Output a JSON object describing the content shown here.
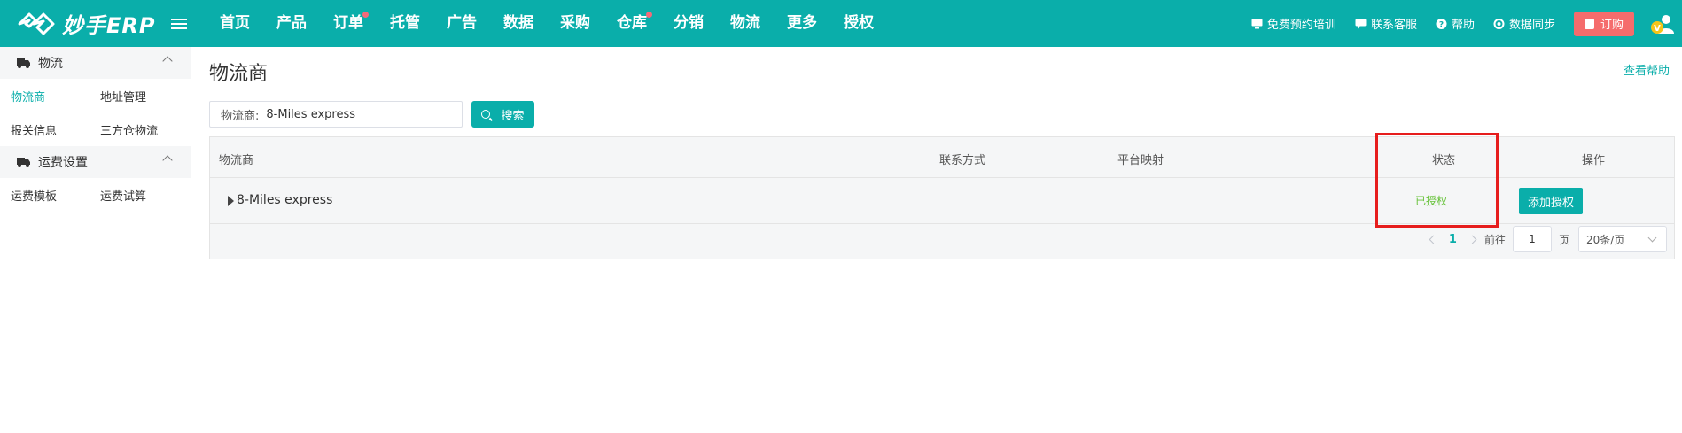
{
  "app": {
    "logo_text": "妙手ERP"
  },
  "nav": {
    "items": [
      {
        "label": "首页",
        "dot": false
      },
      {
        "label": "产品",
        "dot": false
      },
      {
        "label": "订单",
        "dot": true
      },
      {
        "label": "托管",
        "dot": false
      },
      {
        "label": "广告",
        "dot": false
      },
      {
        "label": "数据",
        "dot": false
      },
      {
        "label": "采购",
        "dot": false
      },
      {
        "label": "仓库",
        "dot": true
      },
      {
        "label": "分销",
        "dot": false
      },
      {
        "label": "物流",
        "dot": false
      },
      {
        "label": "更多",
        "dot": false
      },
      {
        "label": "授权",
        "dot": false
      }
    ]
  },
  "top_right": {
    "training": "免费预约培训",
    "support": "联系客服",
    "help": "帮助",
    "sync": "数据同步",
    "order": "订购"
  },
  "sidebar": {
    "group1": {
      "title": "物流"
    },
    "links1": [
      "物流商",
      "地址管理",
      "报关信息",
      "三方仓物流"
    ],
    "group2": {
      "title": "运费设置"
    },
    "links2": [
      "运费模板",
      "运费试算"
    ]
  },
  "main": {
    "title": "物流商",
    "help_link": "查看帮助",
    "search": {
      "label": "物流商:",
      "value": "8-Miles express",
      "button": "搜索"
    },
    "table": {
      "headers": {
        "carrier": "物流商",
        "contact": "联系方式",
        "mapping": "平台映射",
        "status": "状态",
        "action": "操作"
      },
      "rows": [
        {
          "name": "8-Miles express",
          "status": "已授权",
          "action": "添加授权"
        }
      ]
    },
    "pager": {
      "current": "1",
      "goto_label": "前往",
      "goto_value": "1",
      "page_unit": "页",
      "page_size": "20条/页"
    }
  },
  "colors": {
    "brand": "#0aaeaa",
    "status_ok": "#67c23a",
    "highlight": "#e61d1d",
    "order_button": "#f56c6c"
  }
}
